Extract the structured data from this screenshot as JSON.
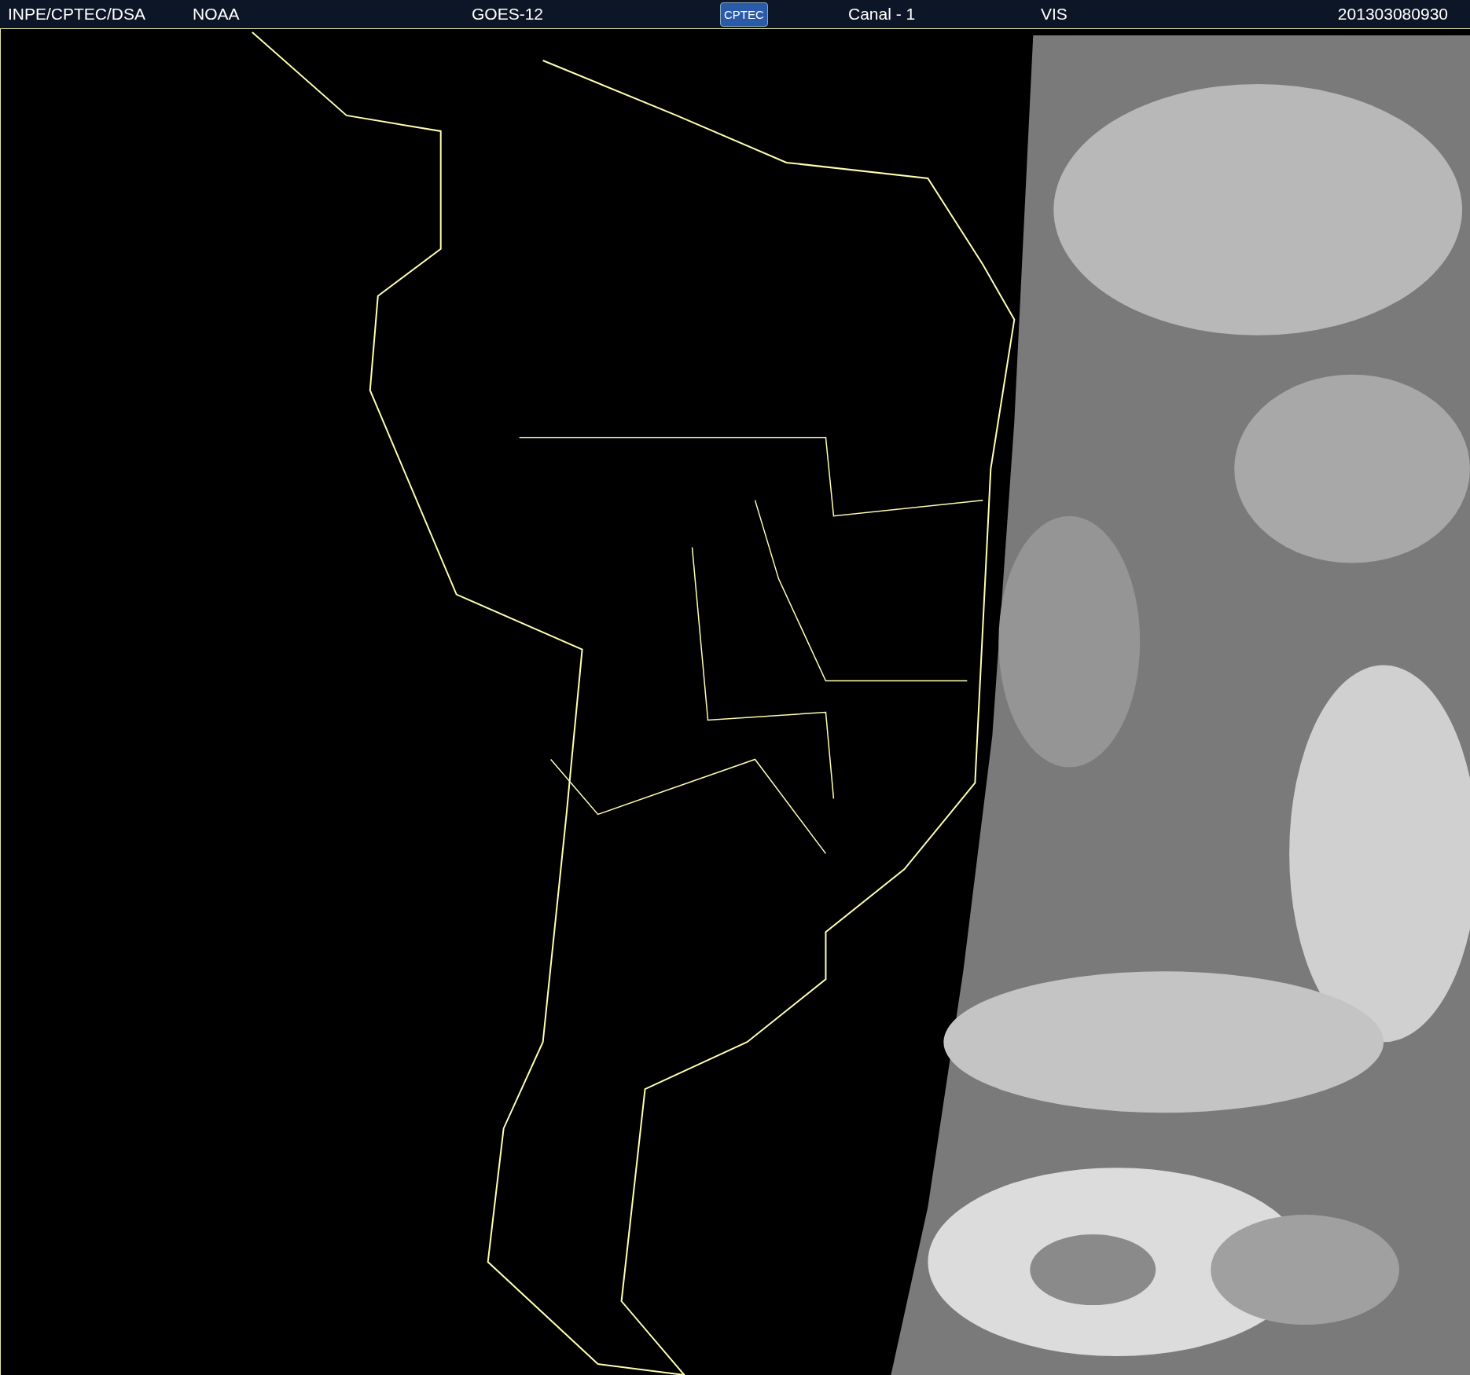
{
  "header": {
    "agency": "INPE/CPTEC/DSA",
    "source": "NOAA",
    "satellite": "GOES-12",
    "logo": "CPTEC",
    "channel": "Canal - 1",
    "band": "VIS",
    "timestamp": "201303080930"
  }
}
